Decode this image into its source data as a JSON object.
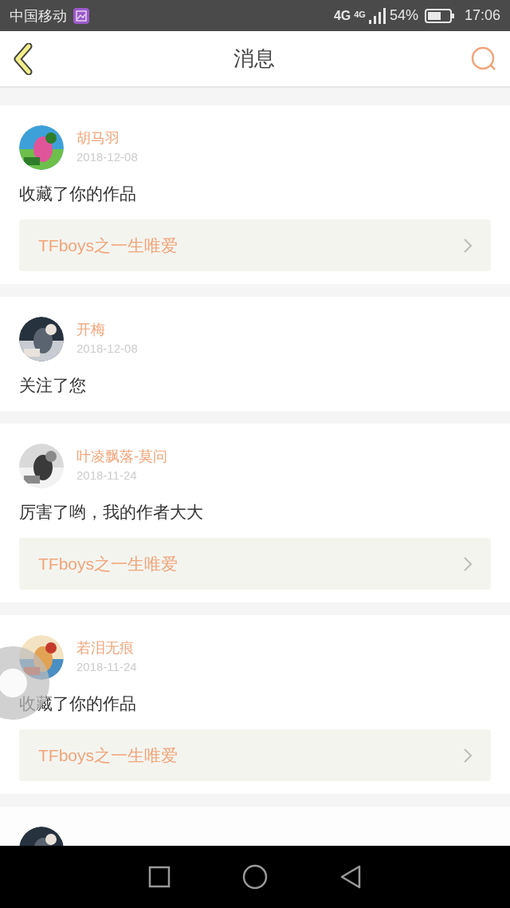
{
  "status_bar": {
    "carrier": "中国移动",
    "network_1": "4G",
    "network_2": "4G",
    "battery": "54%",
    "time": "17:06"
  },
  "header": {
    "title": "消息"
  },
  "messages": [
    {
      "kind": "message",
      "name": "胡马羽",
      "date": "2018-12-08",
      "text": "收藏了你的作品",
      "work": "TFboys之一生唯爱"
    },
    {
      "kind": "message",
      "name": "开梅",
      "date": "2018-12-08",
      "text": "关注了您"
    },
    {
      "kind": "message",
      "name": "叶凌飘落-莫问",
      "date": "2018-11-24",
      "text": "厉害了哟，我的作者大大",
      "work": "TFboys之一生唯爱"
    },
    {
      "kind": "message",
      "name": "若泪无痕",
      "date": "2018-11-24",
      "text": "收藏了你的作品",
      "work": "TFboys之一生唯爱"
    },
    {
      "kind": "cut_off"
    }
  ]
}
